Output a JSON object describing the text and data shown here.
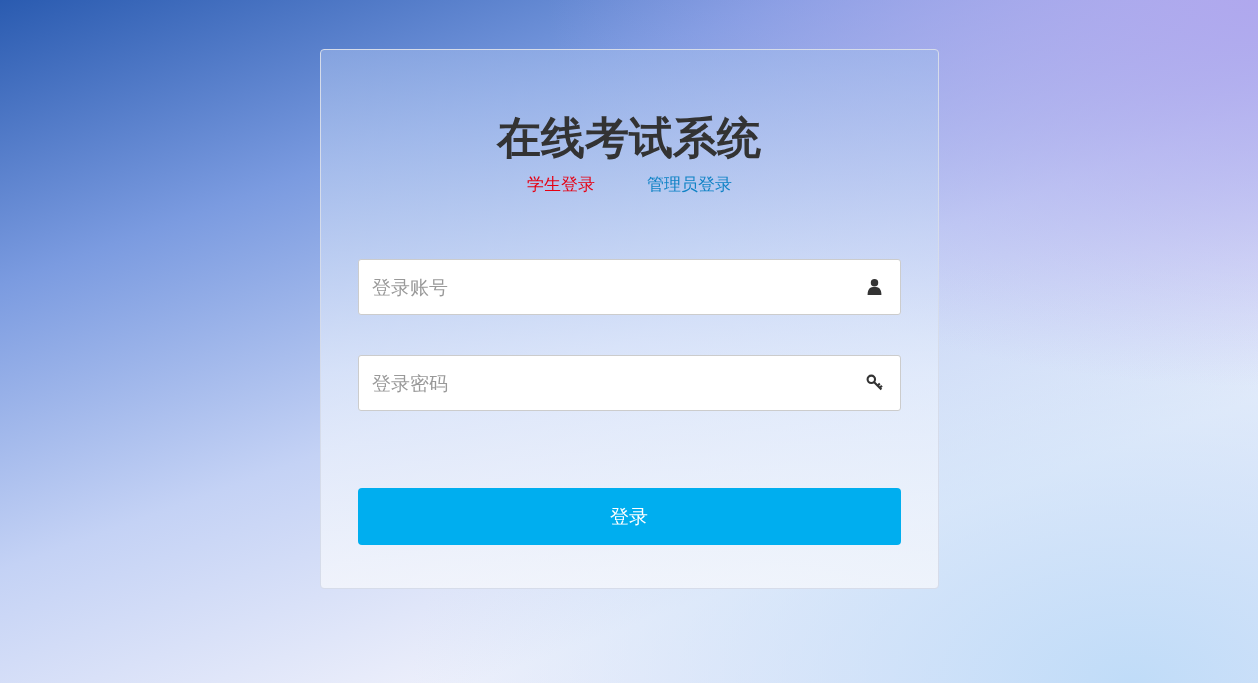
{
  "title": "在线考试系统",
  "tabs": [
    {
      "label": "学生登录",
      "selected": true
    },
    {
      "label": "管理员登录",
      "selected": false
    }
  ],
  "fields": [
    {
      "placeholder": "登录账号",
      "kind": "user"
    },
    {
      "placeholder": "登录密码",
      "kind": "password"
    }
  ],
  "submit": "登录"
}
